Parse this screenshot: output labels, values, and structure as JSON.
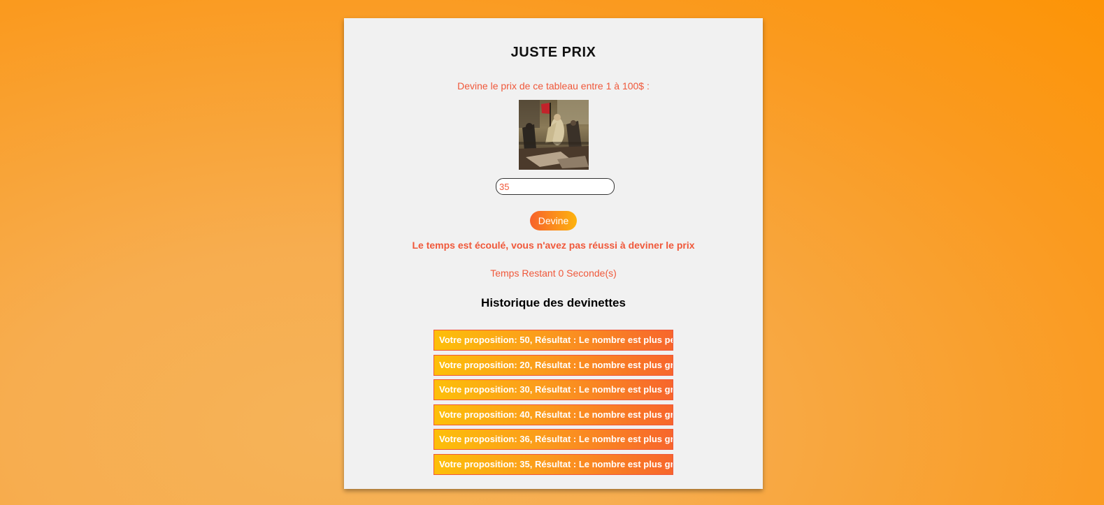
{
  "game": {
    "title": "JUSTE PRIX",
    "prompt": "Devine le prix de ce tableau entre 1 à 100$ :",
    "input_value": "35",
    "button_label": "Devine",
    "timeout_message": "Le temps est écoulé, vous n'avez pas réussi à deviner le prix",
    "timer_text": "Temps Restant 0 Seconde(s)"
  },
  "history": {
    "title": "Historique des devinettes",
    "items": [
      "Votre proposition: 50, Résultat : Le nombre est plus petit",
      "Votre proposition: 20, Résultat : Le nombre est plus grand",
      "Votre proposition: 30, Résultat : Le nombre est plus grand",
      "Votre proposition: 40, Résultat : Le nombre est plus grand",
      "Votre proposition: 36, Résultat : Le nombre est plus grand",
      "Votre proposition: 35, Résultat : Le nombre est plus grand"
    ]
  },
  "colors": {
    "accent_text": "#f0583a",
    "card_background": "#f1f1f1"
  }
}
